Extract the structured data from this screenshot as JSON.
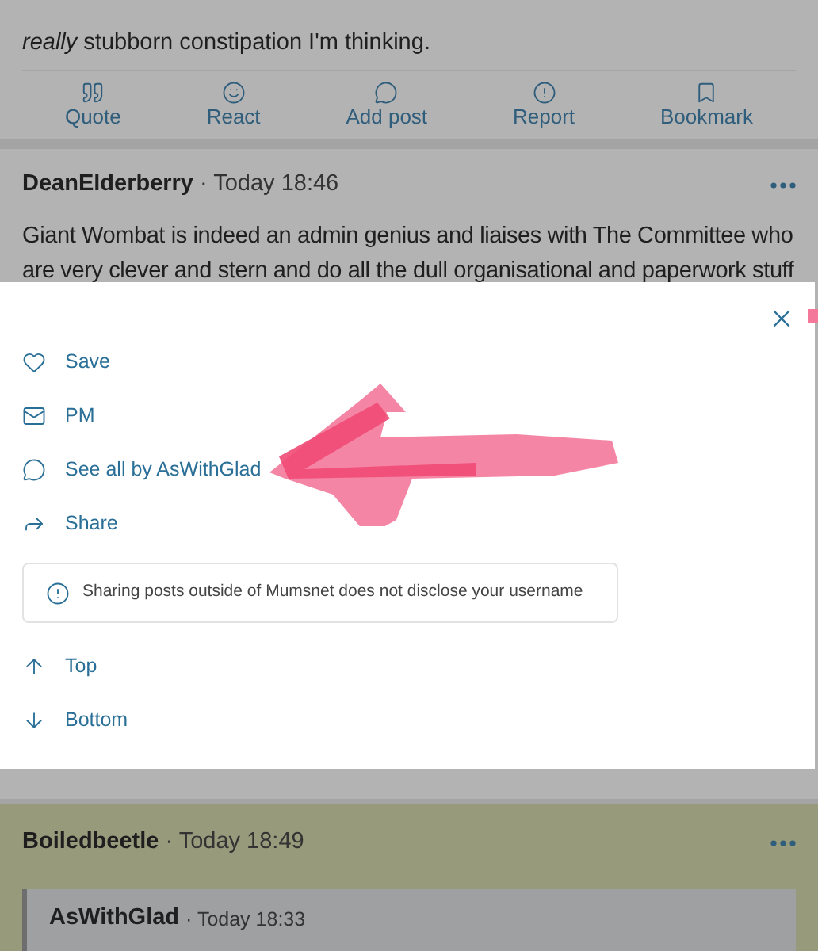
{
  "previous_post": {
    "body_lines": [
      "*really* stubborn constipation I'm thinking."
    ],
    "actions": [
      {
        "label": "Quote",
        "kind": "quote"
      },
      {
        "label": "React",
        "kind": "react"
      },
      {
        "label": "Add post",
        "kind": "comment"
      },
      {
        "label": "Report",
        "kind": "report"
      },
      {
        "label": "Bookmark",
        "kind": "bookmark"
      }
    ]
  },
  "post": {
    "author": "DeanElderberry",
    "time": "· Today 18:46",
    "body_lines": [
      "Giant Wombat is indeed an admin genius and liaises with The Committee who",
      "are very clever and stern and do all the dull organisational and paperwork stuff"
    ]
  },
  "menu": {
    "items": [
      {
        "label": "Save",
        "kind": "heart"
      },
      {
        "label": "PM",
        "kind": "mail"
      },
      {
        "label": "See all by AsWithGlad",
        "kind": "comment"
      },
      {
        "label": "Share",
        "kind": "share"
      }
    ],
    "notice": "Sharing posts outside of Mumsnet does not disclose your username",
    "nav_items": [
      {
        "label": "Top",
        "kind": "up"
      },
      {
        "label": "Bottom",
        "kind": "down"
      }
    ]
  },
  "next_post": {
    "author": "Boiledbeetle",
    "time": "· Today 18:49",
    "quote": {
      "author": "AsWithGlad",
      "time": "· Today 18:33"
    }
  }
}
